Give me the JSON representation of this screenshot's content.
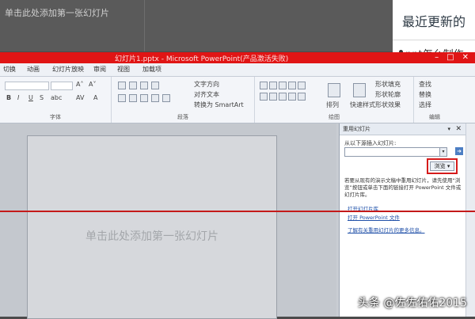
{
  "background": {
    "prev_slide_text": "单击此处添加第一张幻灯片",
    "web_title": "最近更新的",
    "web_bullet": "ppt怎么制作"
  },
  "window": {
    "title": "幻灯片1.pptx - Microsoft PowerPoint(产品激活失败)",
    "controls": [
      "–",
      "□",
      "✕"
    ],
    "title_bar_color": "#e01515"
  },
  "menu": {
    "items": [
      "切换",
      "动画",
      "幻灯片放映",
      "审阅",
      "视图",
      "加载项"
    ]
  },
  "ribbon": {
    "groups": [
      {
        "label": "字体"
      },
      {
        "label": "段落",
        "buttons": [
          "文字方向",
          "对齐文本",
          "转换为 SmartArt"
        ]
      },
      {
        "label": "绘图",
        "buttons": [
          "排列",
          "快速样式",
          "形状填充",
          "形状轮廓",
          "形状效果"
        ]
      },
      {
        "label": "编辑",
        "buttons": [
          "查找",
          "替换",
          "选择"
        ]
      }
    ]
  },
  "slide": {
    "placeholder": "单击此处添加第一张幻灯片"
  },
  "task_pane": {
    "title": "重用幻灯片",
    "from_label": "从以下源插入幻灯片:",
    "browse_label": "浏览 ▾",
    "description": "若要从现有的演示文稿中重用幻灯片，请先使用“浏览”按钮或单击下面的链接打开 PowerPoint 文件或幻灯片库。",
    "links": [
      "打开幻灯片库",
      "打开 PowerPoint 文件",
      "了解有关重用幻灯片的更多信息。"
    ]
  },
  "watermark": "头条 @佐佐佑佑2015"
}
